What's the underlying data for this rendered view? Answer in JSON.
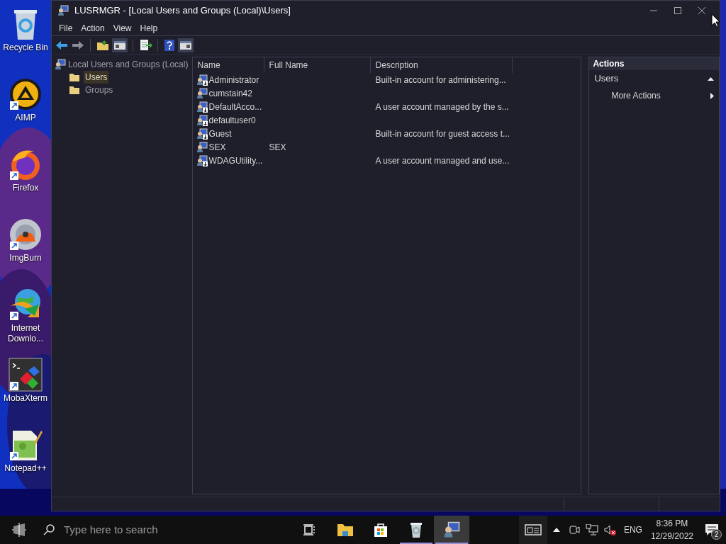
{
  "desktop_icons": [
    {
      "kind": "recycle",
      "label": "Recycle Bin",
      "shortcut": false
    },
    {
      "kind": "aimp",
      "label": "AIMP",
      "shortcut": true
    },
    {
      "kind": "firefox",
      "label": "Firefox",
      "shortcut": true
    },
    {
      "kind": "disc",
      "label": "ImgBurn",
      "shortcut": true
    },
    {
      "kind": "globe",
      "label": "Internet Downlo...",
      "shortcut": true
    },
    {
      "kind": "terminal",
      "label": "MobaXterm",
      "shortcut": true
    },
    {
      "kind": "notepad",
      "label": "Notepad++",
      "shortcut": true
    }
  ],
  "window": {
    "title": "LUSRMGR - [Local Users and Groups (Local)\\Users]"
  },
  "menu": [
    "File",
    "Action",
    "View",
    "Help"
  ],
  "tree": {
    "label": "Local Users and Groups (Local)",
    "children": [
      {
        "label": "Users",
        "selected": true
      },
      {
        "label": "Groups",
        "selected": false
      }
    ]
  },
  "list": {
    "columns": [
      "Name",
      "Full Name",
      "Description"
    ],
    "rows": [
      {
        "kind": "user",
        "name": "Administrator",
        "full_name": "",
        "description": "Built-in account for administering..."
      },
      {
        "kind": "admin",
        "name": "cumstain42",
        "full_name": "",
        "description": ""
      },
      {
        "kind": "user",
        "name": "DefaultAcco...",
        "full_name": "",
        "description": "A user account managed by the s..."
      },
      {
        "kind": "user",
        "name": "defaultuser0",
        "full_name": "",
        "description": ""
      },
      {
        "kind": "user",
        "name": "Guest",
        "full_name": "",
        "description": "Built-in account for guest access t..."
      },
      {
        "kind": "admin",
        "name": "SEX",
        "full_name": "SEX",
        "description": ""
      },
      {
        "kind": "user",
        "name": "WDAGUtility...",
        "full_name": "",
        "description": "A user account managed and use..."
      }
    ]
  },
  "actions": {
    "header": "Actions",
    "section": {
      "label": "Users",
      "expanded": true
    },
    "items": [
      "More Actions"
    ]
  },
  "taskbar": {
    "search_placeholder": "Type here to search",
    "apps": [
      {
        "kind": "taskview",
        "running": false,
        "selected": false
      },
      {
        "kind": "explorer",
        "running": false,
        "selected": false
      },
      {
        "kind": "store",
        "running": false,
        "selected": false
      },
      {
        "kind": "recycle",
        "running": true,
        "selected": false
      },
      {
        "kind": "users",
        "running": true,
        "selected": true
      }
    ],
    "language": "ENG",
    "time": "8:36 PM",
    "date": "12/29/2022",
    "notifications": "2"
  }
}
